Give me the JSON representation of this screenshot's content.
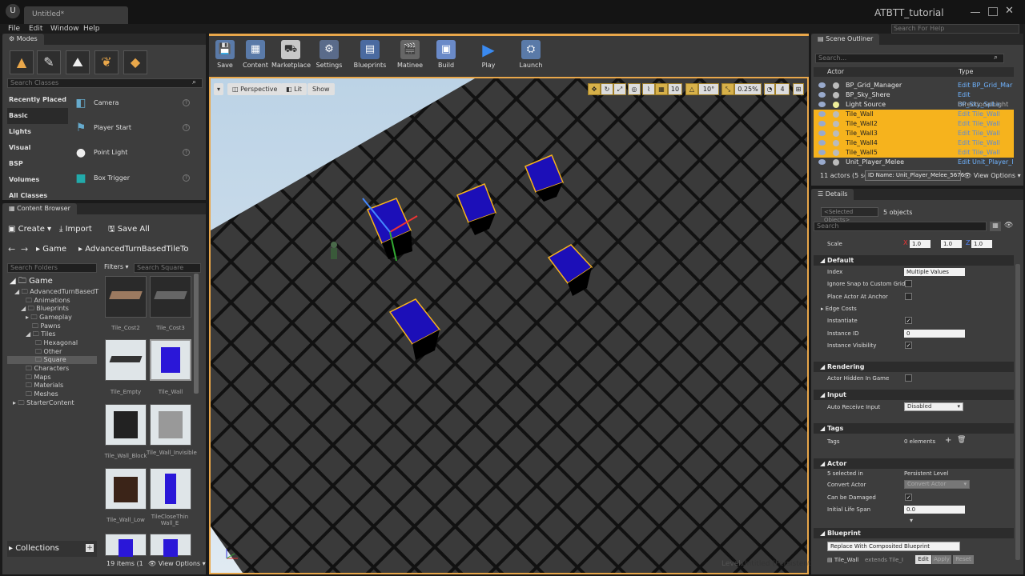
{
  "titlebar": {
    "logo": "U",
    "doc_tab": "Untitled*",
    "app_title": "ATBTT_tutorial"
  },
  "menu": [
    "File",
    "Edit",
    "Window",
    "Help"
  ],
  "help_search": {
    "placeholder": "Search For Help"
  },
  "modes": {
    "tab": "Modes",
    "search_placeholder": "Search Classes",
    "categories": [
      "Recently Placed",
      "Basic",
      "Lights",
      "Visual",
      "BSP",
      "Volumes",
      "All Classes"
    ],
    "selected_category": "Basic",
    "items": [
      {
        "label": "Camera",
        "icon": "camera-icon"
      },
      {
        "label": "Player Start",
        "icon": "player-start-icon"
      },
      {
        "label": "Point Light",
        "icon": "point-light-icon"
      },
      {
        "label": "Box Trigger",
        "icon": "box-trigger-icon"
      }
    ]
  },
  "content_browser": {
    "tab": "Content Browser",
    "create": "Create",
    "import": "Import",
    "save_all": "Save All",
    "path_root": "Game",
    "path_child": "AdvancedTurnBasedTileTo",
    "search_folders": "Search Folders",
    "filters": "Filters",
    "search_assets": "Search Square",
    "tree": [
      "Game",
      "AdvancedTurnBasedT",
      "Animations",
      "Blueprints",
      "Gameplay",
      "Pawns",
      "Tiles",
      "Hexagonal",
      "Other",
      "Square",
      "Characters",
      "Maps",
      "Materials",
      "Meshes",
      "StarterContent"
    ],
    "assets": [
      "Tile_Cost2",
      "Tile_Cost3",
      "Tile_Empty",
      "Tile_Wall",
      "Tile_Wall_Block",
      "Tile_Wall_Invisible",
      "Tile_Wall_Low",
      "TileCloseThin Wall_E"
    ],
    "collections": "Collections",
    "item_count": "19 items (1",
    "view_options": "View Options"
  },
  "toolbar": [
    "Save",
    "Content",
    "Marketplace",
    "Settings",
    "Blueprints",
    "Matinee",
    "Build",
    "Play",
    "Launch"
  ],
  "viewport": {
    "perspective": "Perspective",
    "lit": "Lit",
    "show": "Show",
    "grid_snap": "10",
    "rot_snap": "10°",
    "scale_snap": "0.25%",
    "cam_speed": "4",
    "level_label": "Level:",
    "level_name": "Untitled (Persistent)"
  },
  "outliner": {
    "tab": "Scene Outliner",
    "search_placeholder": "Search...",
    "col_actor": "Actor",
    "col_type": "Type",
    "rows": [
      {
        "name": "BP_Grid_Manager",
        "type": "Edit BP_Grid_Mar",
        "selected": false
      },
      {
        "name": "BP_Sky_Shere",
        "type": "Edit BP_Sky_Sphe",
        "selected": false
      },
      {
        "name": "Light Source",
        "type": "DirectionalLight",
        "selected": false
      },
      {
        "name": "Tile_Wall",
        "type": "Edit Tile_Wall",
        "selected": true
      },
      {
        "name": "Tile_Wall2",
        "type": "Edit Tile_Wall",
        "selected": true
      },
      {
        "name": "Tile_Wall3",
        "type": "Edit Tile_Wall",
        "selected": true
      },
      {
        "name": "Tile_Wall4",
        "type": "Edit Tile_Wall",
        "selected": true
      },
      {
        "name": "Tile_Wall5",
        "type": "Edit Tile_Wall",
        "selected": true
      },
      {
        "name": "Unit_Player_Melee",
        "type": "Edit Unit_Player_I",
        "selected": false
      }
    ],
    "footer": "11 actors (5 se",
    "tooltip": "ID Name: Unit_Player_Melee_5676",
    "view_options": "View Options"
  },
  "details": {
    "tab": "Details",
    "selected_field": "<Selected Objects>",
    "count": "5 objects",
    "search_placeholder": "Search",
    "scale_label": "Scale",
    "scale": {
      "x": "1.0",
      "y": "1.0",
      "z": "1.0"
    },
    "sections": {
      "default": "Default",
      "rendering": "Rendering",
      "input": "Input",
      "tags": "Tags",
      "actor": "Actor",
      "blueprint": "Blueprint"
    },
    "index_label": "Index",
    "index_value": "Multiple Values",
    "ignore_snap": "Ignore Snap to Custom Grid",
    "place_anchor": "Place Actor At Anchor",
    "edge_costs": "Edge Costs",
    "instantiate": "Instantiate",
    "instance_id_label": "Instance ID",
    "instance_id": "0",
    "instance_vis": "Instance Visibility",
    "hidden_game": "Actor Hidden In Game",
    "auto_input_label": "Auto Receive Input",
    "auto_input": "Disabled",
    "tags_label": "Tags",
    "tags_value": "0 elements",
    "selected_in_label": "5 selected in",
    "selected_in": "Persistent Level",
    "convert_label": "Convert Actor",
    "convert": "Convert Actor",
    "can_damaged": "Can be Damaged",
    "life_label": "Initial Life Span",
    "life": "0.0",
    "replace_btn": "Replace With Composited Blueprint",
    "bp_name": "Tile_Wall",
    "bp_extends": "extends Tile_I",
    "edit": "Edit",
    "apply": "Apply",
    "reset": "Reset"
  },
  "colors": {
    "selection": "#f6b31d",
    "cube": "#1c0fb8",
    "accent": "#e9a74a"
  }
}
